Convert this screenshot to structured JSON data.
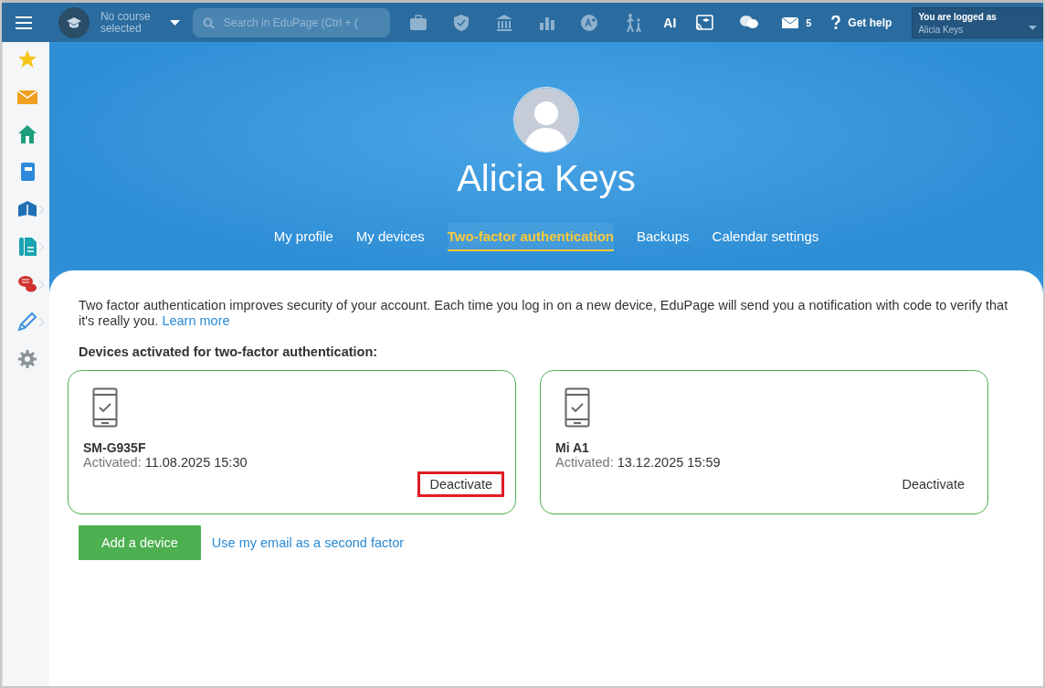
{
  "top_bar": {
    "course_selector": "No course selected",
    "search": {
      "placeholder": "Search in EduPage (Ctrl + ("
    },
    "ai_label": "AI",
    "messages_count": "5",
    "help": "Get help",
    "account": {
      "caption": "You are logged as",
      "name": "Alicia Keys"
    }
  },
  "profile": {
    "name": "Alicia Keys"
  },
  "tabs": [
    {
      "label": "My profile",
      "selected": false
    },
    {
      "label": "My devices",
      "selected": false
    },
    {
      "label": "Two-factor authentication",
      "selected": true
    },
    {
      "label": "Backups",
      "selected": false
    },
    {
      "label": "Calendar settings",
      "selected": false
    }
  ],
  "intro": "Two factor authentication improves security of your account. Each time you log in on a new device, EduPage will send you a notification with code to verify that it's really you.",
  "learn_more": "Learn more",
  "devices_heading": "Devices activated for two-factor authentication:",
  "devices": [
    {
      "name": "SM-G935F",
      "activated_label": "Activated:",
      "activated": "11.08.2025 15:30",
      "action": "Deactivate",
      "highlighted": true
    },
    {
      "name": "Mi A1",
      "activated_label": "Activated:",
      "activated": "13.12.2025 15:59",
      "action": "Deactivate",
      "highlighted": false
    }
  ],
  "add_button": "Add a device",
  "email_link": "Use my email as a second factor"
}
